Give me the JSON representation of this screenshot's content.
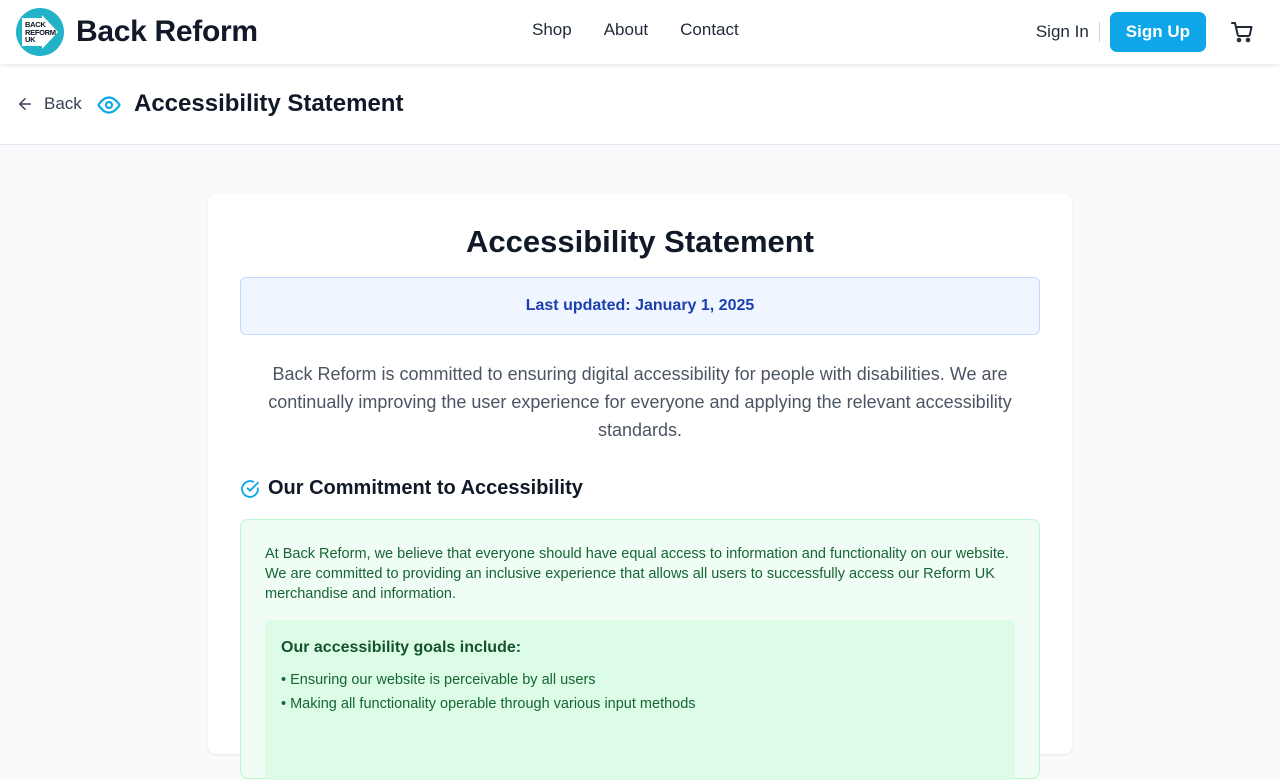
{
  "header": {
    "logo_text": [
      "BACK",
      "REFORM",
      "UK"
    ],
    "brand": "Back Reform",
    "nav": [
      "Shop",
      "About",
      "Contact"
    ],
    "sign_in": "Sign In",
    "sign_up": "Sign Up"
  },
  "subheader": {
    "back_label": "Back",
    "title": "Accessibility Statement"
  },
  "content": {
    "heading": "Accessibility Statement",
    "last_updated": "Last updated: January 1, 2025",
    "intro": "Back Reform is committed to ensuring digital accessibility for people with disabilities. We are continually improving the user experience for everyone and applying the relevant accessibility standards.",
    "commitment": {
      "title": "Our Commitment to Accessibility",
      "text": "At Back Reform, we believe that everyone should have equal access to information and functionality on our website. We are committed to providing an inclusive experience that allows all users to successfully access our Reform UK merchandise and information.",
      "goals_title": "Our accessibility goals include:",
      "goals": [
        "• Ensuring our website is perceivable by all users",
        "• Making all functionality operable through various input methods"
      ]
    }
  },
  "colors": {
    "accent": "#0ea5e9",
    "logo": "#22b3c9",
    "info_bg": "#eff6ff",
    "info_text": "#1e40af",
    "success_bg": "#f0fdf4",
    "success_text": "#166534"
  },
  "icons": {
    "back": "arrow-left-icon",
    "title": "eye-icon",
    "section": "check-circle-icon",
    "cart": "shopping-cart-icon"
  }
}
